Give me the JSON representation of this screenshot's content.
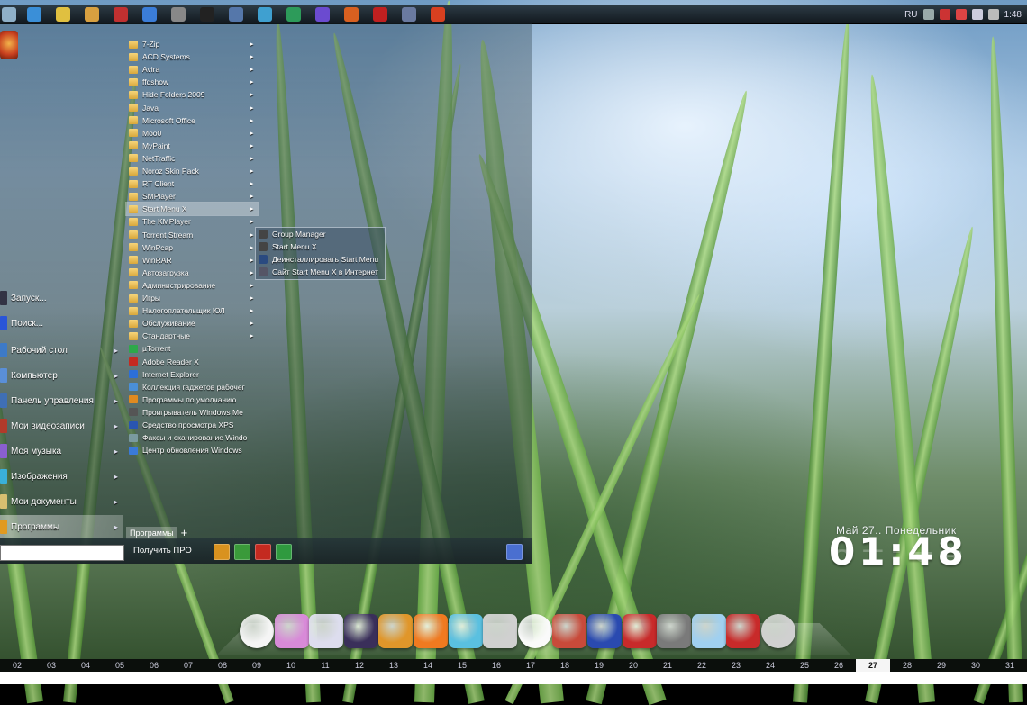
{
  "top_taskbar": {
    "icons": [
      "start-orb-icon",
      "water-drop-icon",
      "picture-icon",
      "star-folder-icon",
      "document-icon",
      "browser-icon",
      "tools-icon",
      "video-icon",
      "monitor-icon",
      "network-icon",
      "chat-icon",
      "mail-icon",
      "shapes-icon",
      "flag-icon",
      "disk-icon",
      "app-icon"
    ],
    "tray": {
      "language": "RU",
      "time": "1:48"
    }
  },
  "left_column": {
    "items": [
      {
        "label": "Запуск...",
        "arrow": ""
      },
      {
        "label": "Поиск...",
        "arrow": ""
      },
      {
        "label": "Рабочий стол",
        "arrow": "▸"
      },
      {
        "label": "Компьютер",
        "arrow": "▸"
      },
      {
        "label": "Панель управления",
        "arrow": "▸"
      },
      {
        "label": "Мои видеозаписи",
        "arrow": "▸"
      },
      {
        "label": "Моя музыка",
        "arrow": "▸"
      },
      {
        "label": "Изображения",
        "arrow": "▸"
      },
      {
        "label": "Мои документы",
        "arrow": "▸"
      },
      {
        "label": "Программы",
        "arrow": "▸"
      }
    ],
    "active_index": 9
  },
  "programs": {
    "items": [
      {
        "label": "7-Zip",
        "folder": true,
        "arrow": "▸"
      },
      {
        "label": "ACD Systems",
        "folder": true,
        "arrow": "▸"
      },
      {
        "label": "Avira",
        "folder": true,
        "arrow": "▸"
      },
      {
        "label": "ffdshow",
        "folder": true,
        "arrow": "▸"
      },
      {
        "label": "Hide Folders 2009",
        "folder": true,
        "arrow": "▸"
      },
      {
        "label": "Java",
        "folder": true,
        "arrow": "▸"
      },
      {
        "label": "Microsoft Office",
        "folder": true,
        "arrow": "▸"
      },
      {
        "label": "Moo0",
        "folder": true,
        "arrow": "▸"
      },
      {
        "label": "MyPaint",
        "folder": true,
        "arrow": "▸"
      },
      {
        "label": "NetTraffic",
        "folder": true,
        "arrow": "▸"
      },
      {
        "label": "Noroz Skin Pack",
        "folder": true,
        "arrow": "▸"
      },
      {
        "label": "RT Client",
        "folder": true,
        "arrow": "▸"
      },
      {
        "label": "SMPlayer",
        "folder": true,
        "arrow": "▸"
      },
      {
        "label": "Start Menu X",
        "folder": true,
        "arrow": "▸"
      },
      {
        "label": "The KMPlayer",
        "folder": true,
        "arrow": "▸"
      },
      {
        "label": "Torrent Stream",
        "folder": true,
        "arrow": "▸"
      },
      {
        "label": "WinPcap",
        "folder": true,
        "arrow": "▸"
      },
      {
        "label": "WinRAR",
        "folder": true,
        "arrow": "▸"
      },
      {
        "label": "Автозагрузка",
        "folder": true,
        "arrow": "▸"
      },
      {
        "label": "Администрирование",
        "folder": true,
        "arrow": "▸"
      },
      {
        "label": "Игры",
        "folder": true,
        "arrow": "▸"
      },
      {
        "label": "Налогоплательщик ЮЛ",
        "folder": true,
        "arrow": "▸"
      },
      {
        "label": "Обслуживание",
        "folder": true,
        "arrow": "▸"
      },
      {
        "label": "Стандартные",
        "folder": true,
        "arrow": "▸"
      },
      {
        "label": "µTorrent",
        "folder": false,
        "arrow": ""
      },
      {
        "label": "Adobe Reader X",
        "folder": false,
        "arrow": ""
      },
      {
        "label": "Internet Explorer",
        "folder": false,
        "arrow": ""
      },
      {
        "label": "Коллекция гаджетов рабочег",
        "folder": false,
        "arrow": ""
      },
      {
        "label": "Программы по умолчанию",
        "folder": false,
        "arrow": ""
      },
      {
        "label": "Проигрыватель Windows Me",
        "folder": false,
        "arrow": ""
      },
      {
        "label": "Средство просмотра XPS",
        "folder": false,
        "arrow": ""
      },
      {
        "label": "Факсы и сканирование Windo",
        "folder": false,
        "arrow": ""
      },
      {
        "label": "Центр обновления Windows",
        "folder": false,
        "arrow": ""
      }
    ],
    "hover_index": 13
  },
  "submenu": {
    "items": [
      {
        "label": "Group Manager"
      },
      {
        "label": "Start Menu X"
      },
      {
        "label": "Деинсталлировать Start Menu"
      },
      {
        "label": "Сайт Start Menu X в Интернет"
      }
    ]
  },
  "tabs": {
    "programs_label": "Программы",
    "add_label": "+"
  },
  "bottom_bar": {
    "search_value": "",
    "get_pro_label": "Получить ПРО"
  },
  "clock_widget": {
    "date": "Май 27.. Понедельник",
    "time": "01:48"
  },
  "dock": {
    "icons": [
      "clock-icon",
      "gamepad-icon",
      "printer-icon",
      "user-suit-icon",
      "pumpkin-icon",
      "rss-icon",
      "globe-icon",
      "download-icon",
      "soccer-ball-icon",
      "paint-icon",
      "book-icon",
      "paint-bucket-icon",
      "phone-icon",
      "screen-icon",
      "chart-icon",
      "power-icon"
    ]
  },
  "date_strip": {
    "days": [
      "02",
      "03",
      "04",
      "05",
      "06",
      "07",
      "08",
      "09",
      "10",
      "11",
      "12",
      "13",
      "14",
      "15",
      "16",
      "17",
      "18",
      "19",
      "20",
      "21",
      "22",
      "23",
      "24",
      "25",
      "26",
      "27",
      "28",
      "29",
      "30",
      "31"
    ],
    "today": "27"
  }
}
